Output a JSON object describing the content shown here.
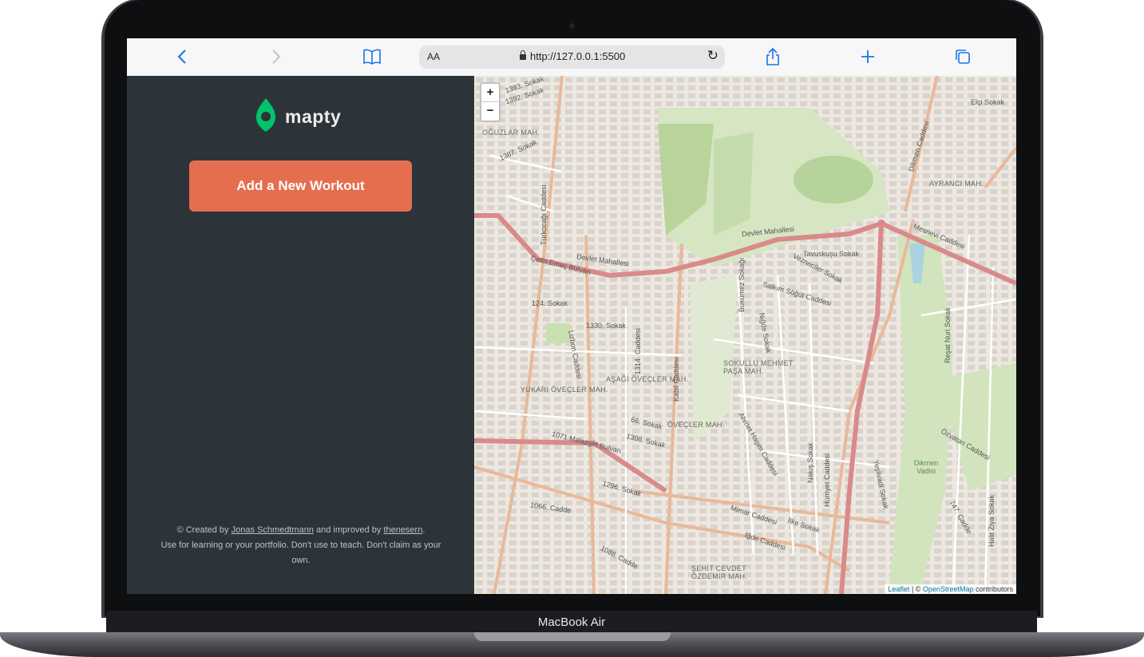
{
  "browser": {
    "url": "http://127.0.0.1:5500",
    "text_size_label": "AA",
    "icons": [
      "back-icon",
      "forward-icon",
      "bookmarks-icon",
      "share-icon",
      "new-tab-icon",
      "tabs-icon",
      "reload-icon",
      "lock-icon"
    ]
  },
  "device": {
    "label": "MacBook Air"
  },
  "sidebar": {
    "logo_text": "mapty",
    "add_button": "Add a New Workout",
    "credits": {
      "prefix": "© Created by",
      "author": "Jonas Schmedtmann",
      "middle": "and improved by",
      "improver": "thenesern",
      "suffix": ".",
      "line2": "Use for learning or your portfolio. Don't use to teach. Don't claim as your own."
    },
    "colors": {
      "background": "#2d3439",
      "button": "#e56e4f",
      "logo_pin": "#00c46a"
    }
  },
  "map": {
    "zoom_in": "+",
    "zoom_out": "−",
    "attribution": {
      "leaflet": "Leaflet",
      "sep": " | © ",
      "osm": "OpenStreetMap",
      "suffix": " contributors"
    },
    "labels": {
      "l1": "1393. Sokak",
      "l2": "1392. Sokak",
      "l3": "OĞUZLAR MAH.",
      "l4": "1387. Sokak",
      "l5": "Çetin Emeç Bulvarı",
      "l6": "Devlet Mahallesi",
      "l7": "124. Sokak",
      "l8": "1330. Sokak",
      "l9": "AŞAĞI ÖVEÇLER MAH.",
      "l10": "YUKARI ÖVEÇLER MAH.",
      "l11": "66. Sokak",
      "l12": "ÖVEÇLER MAH.",
      "l13": "1308. Sokak",
      "l14": "1071 Malazgirt Bulvarı",
      "l15": "1296. Sokak",
      "l16": "1066. Cadde",
      "l17": "Mimar Caddesi",
      "l18": "İlke Sokak",
      "l19": "İğde Caddesi",
      "l20": "ŞEHİT CEVDET ÖZDEMİR MAH.",
      "l21": "1088. Cadde",
      "l22": "SOKULLU MEHMET PAŞA MAH.",
      "l23": "Salkım Söğüt Caddesi",
      "l24": "Vezneciler Sokak",
      "l25": "Tavuskuşu Sokak",
      "l26": "Mesnevi Caddesi",
      "l27": "Elçi Sokak",
      "l28": "AYRANCI MAH.",
      "l29": "Dikmen Caddesi",
      "l30": "Devlet Mahallesi",
      "l31": "Dikmen Vadisi",
      "l32": "Yeşilvadi Sokak",
      "l33": "Hürriyet Caddesi",
      "l34": "Ahmet Haşim Caddesi",
      "l35": "Nakış Sokak",
      "l36": "Özvatan Caddesi",
      "l37": "747. Cadde",
      "l38": "Halit Ziya Sokak",
      "l39": "Reşat Nuri Sokak",
      "l40": "Bükümez Sokağı",
      "l41": "Niğde Sokak",
      "l42": "Türkocağı Caddesi",
      "l43": "Lizbon Caddesi",
      "l44": "Kabil Caddesi",
      "l45": "1314. Caddesi"
    },
    "colors": {
      "primary_road": "#d98a8a",
      "secondary_road": "#e8b99a",
      "park": "#c8dfb0",
      "land": "#f1eee8"
    }
  }
}
